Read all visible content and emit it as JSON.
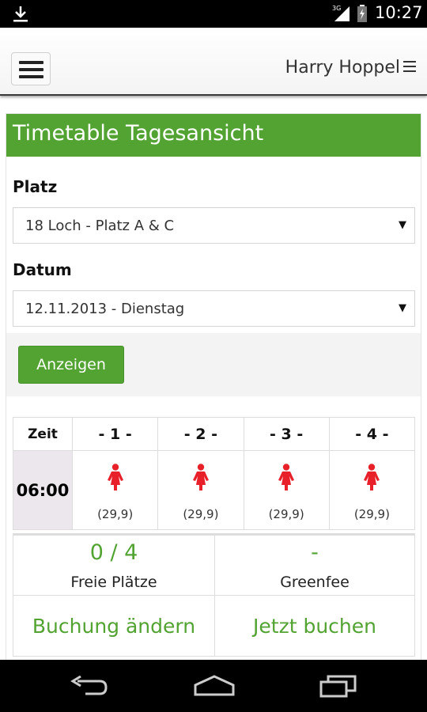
{
  "status_bar": {
    "time": "10:27",
    "network": "3G",
    "icons": [
      "download-icon",
      "signal-icon",
      "battery-icon"
    ]
  },
  "header": {
    "menu_icon": "hamburger-icon",
    "user_name": "Harry Hoppel",
    "user_menu_icon": "list-icon"
  },
  "panel": {
    "title": "Timetable Tagesansicht",
    "platz_label": "Platz",
    "platz_value": "18 Loch - Platz A & C",
    "datum_label": "Datum",
    "datum_value": "12.11.2013 - Dienstag",
    "show_button": "Anzeigen"
  },
  "timetable": {
    "header": [
      "Zeit",
      "- 1 -",
      "- 2 -",
      "- 3 -",
      "- 4 -"
    ],
    "rows": [
      {
        "time": "06:00",
        "slots": [
          {
            "icon": "female-person-icon",
            "price": "(29,9)"
          },
          {
            "icon": "female-person-icon",
            "price": "(29,9)"
          },
          {
            "icon": "female-person-icon",
            "price": "(29,9)"
          },
          {
            "icon": "female-person-icon",
            "price": "(29,9)"
          }
        ]
      }
    ]
  },
  "summary": {
    "free_value": "0 / 4",
    "free_label": "Freie Plätze",
    "greenfee_value": "-",
    "greenfee_label": "Greenfee",
    "change_booking": "Buchung ändern",
    "book_now": "Jetzt buchen"
  },
  "colors": {
    "accent": "#52a331",
    "person": "#e8202a",
    "time_cell": "#ebe7ec"
  },
  "navbar": [
    "back-icon",
    "home-icon",
    "recent-apps-icon"
  ]
}
